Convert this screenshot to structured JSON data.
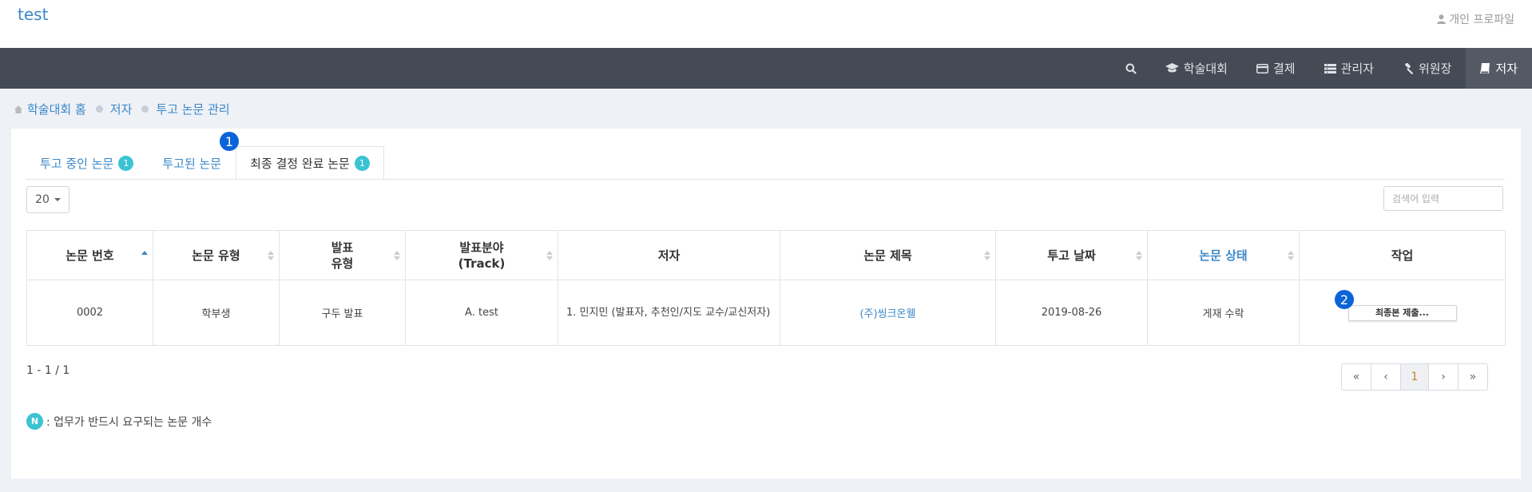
{
  "header": {
    "brand": "test",
    "profile_label": "개인 프로파일"
  },
  "nav": {
    "items": [
      {
        "label": "학술대회",
        "icon": "graduation-cap-icon"
      },
      {
        "label": "결제",
        "icon": "credit-card-icon"
      },
      {
        "label": "관리자",
        "icon": "list-icon"
      },
      {
        "label": "위원장",
        "icon": "gavel-icon"
      },
      {
        "label": "저자",
        "icon": "book-icon",
        "active": true
      }
    ]
  },
  "breadcrumb": [
    "학술대회 홈",
    "저자",
    "투고 논문 관리"
  ],
  "tabs": [
    {
      "label": "투고 중인 논문",
      "badge": "1"
    },
    {
      "label": "투고된 논문",
      "badge": null
    },
    {
      "label": "최종 결정 완료 논문",
      "badge": "1",
      "active": true
    }
  ],
  "markers": {
    "first": "1",
    "second": "2"
  },
  "toolbar": {
    "page_size": "20",
    "search_placeholder": "검색어 입력"
  },
  "table": {
    "headers": [
      {
        "label": "논문 번호",
        "sort": "asc"
      },
      {
        "label": "논문 유형",
        "sort": "both"
      },
      {
        "label": "발표\n유형",
        "sort": "both"
      },
      {
        "label": "발표분야\n(Track)",
        "sort": "both"
      },
      {
        "label": "저자",
        "sort": "none"
      },
      {
        "label": "논문 제목",
        "sort": "both"
      },
      {
        "label": "투고 날짜",
        "sort": "both"
      },
      {
        "label": "논문 상태",
        "sort": "both"
      },
      {
        "label": "작업",
        "sort": "none"
      }
    ],
    "rows": [
      {
        "number": "0002",
        "type": "학부생",
        "presentation": "구두 발표",
        "track": "A. test",
        "authors": "1. 민지민 (발표자, 추천인/지도 교수/교신저자)",
        "title": "(주)씽크온웰",
        "date": "2019-08-26",
        "status": "게재 수락",
        "action": "최종본 제출..."
      }
    ]
  },
  "pagination": {
    "summary": "1 - 1 / 1",
    "first": "«",
    "prev": "‹",
    "current": "1",
    "next": "›",
    "last": "»"
  },
  "legend": {
    "badge": "N",
    "text": ": 업무가 반드시 요구되는 논문 개수"
  },
  "colors": {
    "accent": "#3a87c8",
    "nav_bg": "#444b55",
    "badge": "#3cc3d3",
    "marker": "#0c63d8"
  }
}
